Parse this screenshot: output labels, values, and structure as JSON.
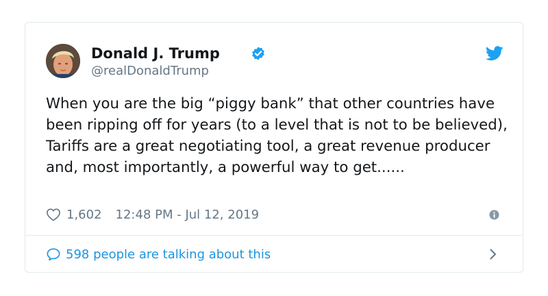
{
  "tweet": {
    "author_name": "Donald J. Trump",
    "handle": "@realDonaldTrump",
    "text": "When you are the big “piggy bank” that other countries have been ripping off for years (to a level that is not to be believed), Tariffs are a great negotiating tool, a great revenue producer and,  most importantly, a powerful way to get......",
    "likes": "1,602",
    "timestamp": "12:48 PM - Jul 12, 2019",
    "talking_text": "598 people are talking about this"
  },
  "icons": {
    "verified": "verified-badge-icon",
    "brand": "twitter-bird-icon",
    "like": "heart-icon",
    "info": "info-icon",
    "reply": "speech-bubble-icon",
    "more": "chevron-right-icon"
  },
  "colors": {
    "brand_blue": "#1da1f2",
    "link_blue": "#1b95e0",
    "text": "#14171a",
    "muted": "#657786",
    "border": "#e1e8ed"
  }
}
